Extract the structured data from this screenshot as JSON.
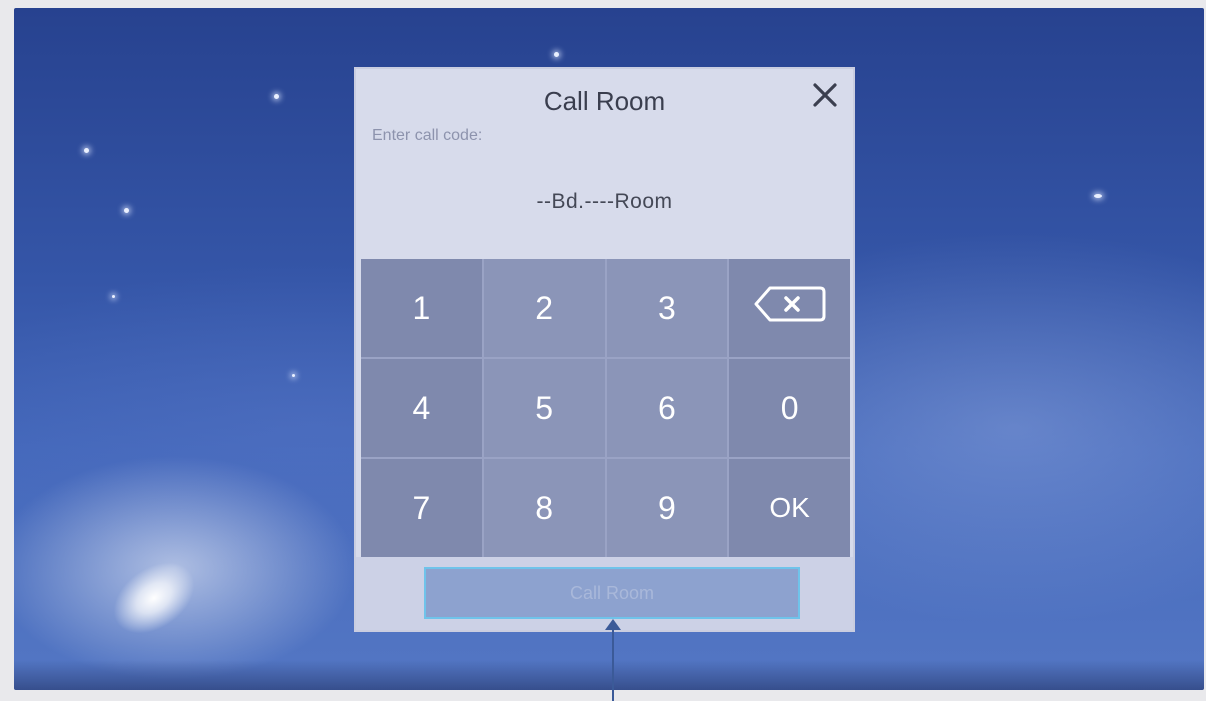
{
  "dialog": {
    "title": "Call Room",
    "prompt": "Enter call code:",
    "code_display": "--Bd.----Room",
    "close_icon": "close-icon"
  },
  "keypad": {
    "keys": [
      {
        "label": "1",
        "name": "key-1"
      },
      {
        "label": "2",
        "name": "key-2"
      },
      {
        "label": "3",
        "name": "key-3"
      },
      {
        "label": "",
        "name": "backspace-button",
        "icon": "backspace-icon"
      },
      {
        "label": "4",
        "name": "key-4"
      },
      {
        "label": "5",
        "name": "key-5"
      },
      {
        "label": "6",
        "name": "key-6"
      },
      {
        "label": "0",
        "name": "key-0"
      },
      {
        "label": "7",
        "name": "key-7"
      },
      {
        "label": "8",
        "name": "key-8"
      },
      {
        "label": "9",
        "name": "key-9"
      },
      {
        "label": "OK",
        "name": "ok-button"
      }
    ]
  },
  "call_button": {
    "label": "Call Room"
  },
  "colors": {
    "background": "#3556a8",
    "dialog": "#d7dbeb",
    "keypad": "#7f89ad",
    "call_button_border": "#6fc3ea"
  }
}
